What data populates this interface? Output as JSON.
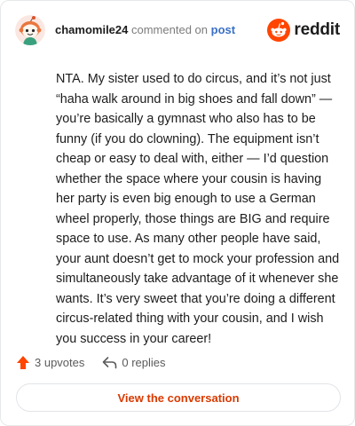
{
  "comment": {
    "username": "chamomile24",
    "action_text": "commented on",
    "post_link": "post",
    "body": "NTA. My sister used to do circus, and it’s not just “haha walk around in big shoes and fall down” — you’re basically a gymnast who also has to be funny (if you do clowning). The equipment isn’t cheap or easy to deal with, either — I’d question whether the space where your cousin is having her party is even big enough to use a German wheel properly, those things are BIG and require space to use. As many other people have said, your aunt doesn’t get to mock your profession and simultaneously take advantage of it whenever she wants. It’s very sweet that you’re doing a different circus-related thing with your cousin, and I wish you success in your career!"
  },
  "brand": {
    "wordmark": "reddit",
    "logo_icon": "reddit-snoo-icon",
    "accent_color": "#ff4500"
  },
  "stats": {
    "upvotes_label": "3 upvotes",
    "upvote_icon": "upvote-arrow-icon",
    "upvote_color": "#ff4500",
    "replies_label": "0 replies",
    "reply_icon": "reply-arrow-icon"
  },
  "cta": {
    "label": "View the conversation",
    "color": "#d93a00"
  }
}
